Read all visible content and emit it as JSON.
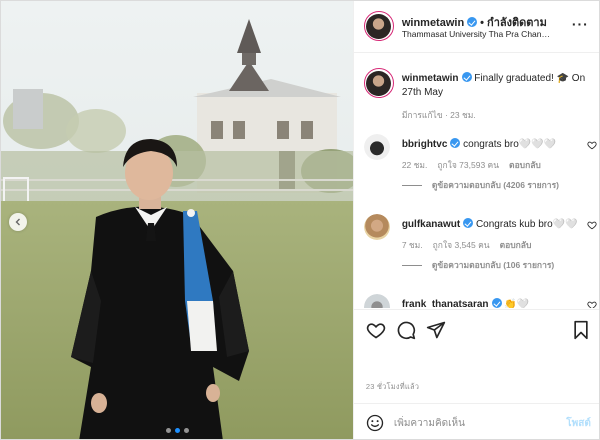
{
  "post": {
    "author": "winmetawin",
    "follow_separator": "•",
    "follow_label": "กำลังติดตาม",
    "location": "Thammasat University Tha Pra Chan Ca...",
    "more_label": "···"
  },
  "caption": {
    "username": "winmetawin",
    "text": "Finally graduated! 🎓 On 27th May",
    "meta": "มีการแก้ไข · 23 ชม."
  },
  "comments": [
    {
      "username": "bbrightvc",
      "text": "congrats bro🤍🤍🤍",
      "time": "22 ชม.",
      "likes": "ถูกใจ 73,593 คน",
      "reply_label": "ตอบกลับ",
      "view_replies": "ดูข้อความตอบกลับ (4206 รายการ)"
    },
    {
      "username": "gulfkanawut",
      "text": "Congrats kub bro🤍🤍",
      "time": "7 ชม.",
      "likes": "ถูกใจ 3,545 คน",
      "reply_label": "ตอบกลับ",
      "view_replies": "ดูข้อความตอบกลับ (106 รายการ)"
    },
    {
      "username": "frank_thanatsaran",
      "text": "👏🤍"
    }
  ],
  "timestamp": "23 ชั่วโมงที่แล้ว",
  "add_comment": {
    "placeholder": "เพิ่มความคิดเห็น",
    "post_label": "โพสต์"
  },
  "carousel": {
    "count": 3,
    "active": 1
  },
  "colors": {
    "verified": "#3897f0",
    "post_button": "#b2dffc",
    "meta": "#8e8e8e",
    "active_dot": "#1e90ff"
  }
}
